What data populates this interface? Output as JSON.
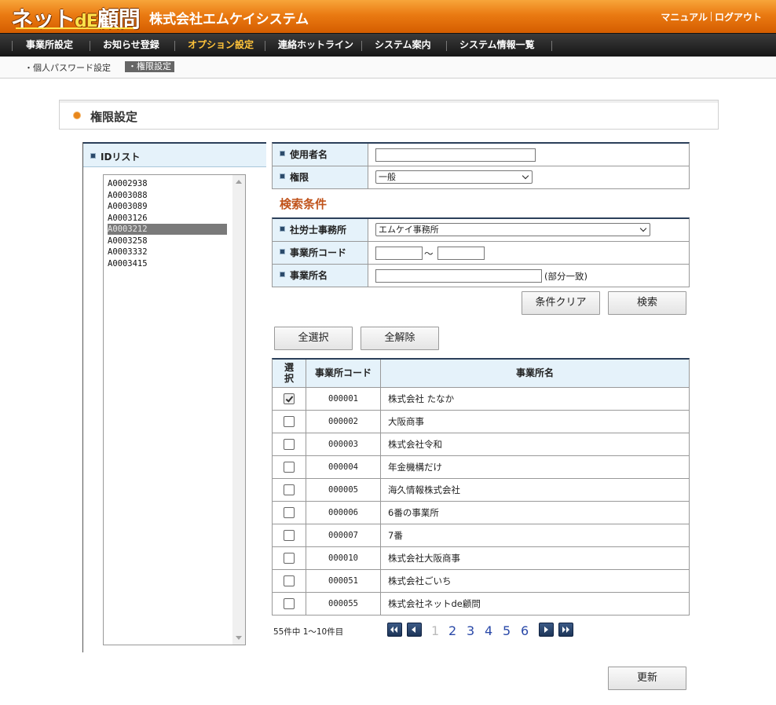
{
  "header": {
    "logo_main": "ネット",
    "logo_de": "dE",
    "logo_tail": "顧問",
    "company": "株式会社エムケイシステム",
    "links": [
      "マニュアル",
      "ログアウト"
    ]
  },
  "nav": {
    "items": [
      "事業所設定",
      "お知らせ登録",
      "オプション設定",
      "連絡ホットライン",
      "システム案内",
      "システム情報一覧"
    ],
    "active_index": 2
  },
  "subnav": {
    "items": [
      "・個人パスワード設定",
      "・権限設定"
    ],
    "active_index": 1
  },
  "page": {
    "title": "権限設定"
  },
  "id_list": {
    "header": "IDリスト",
    "items": [
      "A0002938",
      "A0003088",
      "A0003089",
      "A0003126",
      "A0003212",
      "A0003258",
      "A0003332",
      "A0003415"
    ],
    "selected_index": 4
  },
  "user_form": {
    "username_label": "使用者名",
    "username_value": "",
    "permission_label": "権限",
    "permission_value": "一般"
  },
  "search": {
    "title": "検索条件",
    "office_label": "社労士事務所",
    "office_value": "エムケイ事務所",
    "code_label": "事業所コード",
    "code_from": "",
    "code_tilde": "～",
    "code_to": "",
    "name_label": "事業所名",
    "name_value": "",
    "name_note": "(部分一致)",
    "clear_button": "条件クリア",
    "search_button": "検索"
  },
  "bulk": {
    "select_all": "全選択",
    "deselect_all": "全解除"
  },
  "results": {
    "col_select": "選\n択",
    "col_code": "事業所コード",
    "col_name": "事業所名",
    "rows": [
      {
        "code": "000001",
        "name": "株式会社 たなか",
        "checked": true
      },
      {
        "code": "000002",
        "name": "大阪商事",
        "checked": false
      },
      {
        "code": "000003",
        "name": "株式会社令和",
        "checked": false
      },
      {
        "code": "000004",
        "name": "年金機構だけ",
        "checked": false
      },
      {
        "code": "000005",
        "name": "海久情報株式会社",
        "checked": false
      },
      {
        "code": "000006",
        "name": "6番の事業所",
        "checked": false
      },
      {
        "code": "000007",
        "name": "7番",
        "checked": false
      },
      {
        "code": "000010",
        "name": "株式会社大阪商事",
        "checked": false
      },
      {
        "code": "000051",
        "name": "株式会社ごいち",
        "checked": false
      },
      {
        "code": "000055",
        "name": "株式会社ネットde顧問",
        "checked": false
      }
    ]
  },
  "pagination": {
    "summary": "55件中  1～10件目",
    "pages": [
      "1",
      "2",
      "3",
      "4",
      "5",
      "6"
    ],
    "current": "1"
  },
  "update_button": "更新"
}
